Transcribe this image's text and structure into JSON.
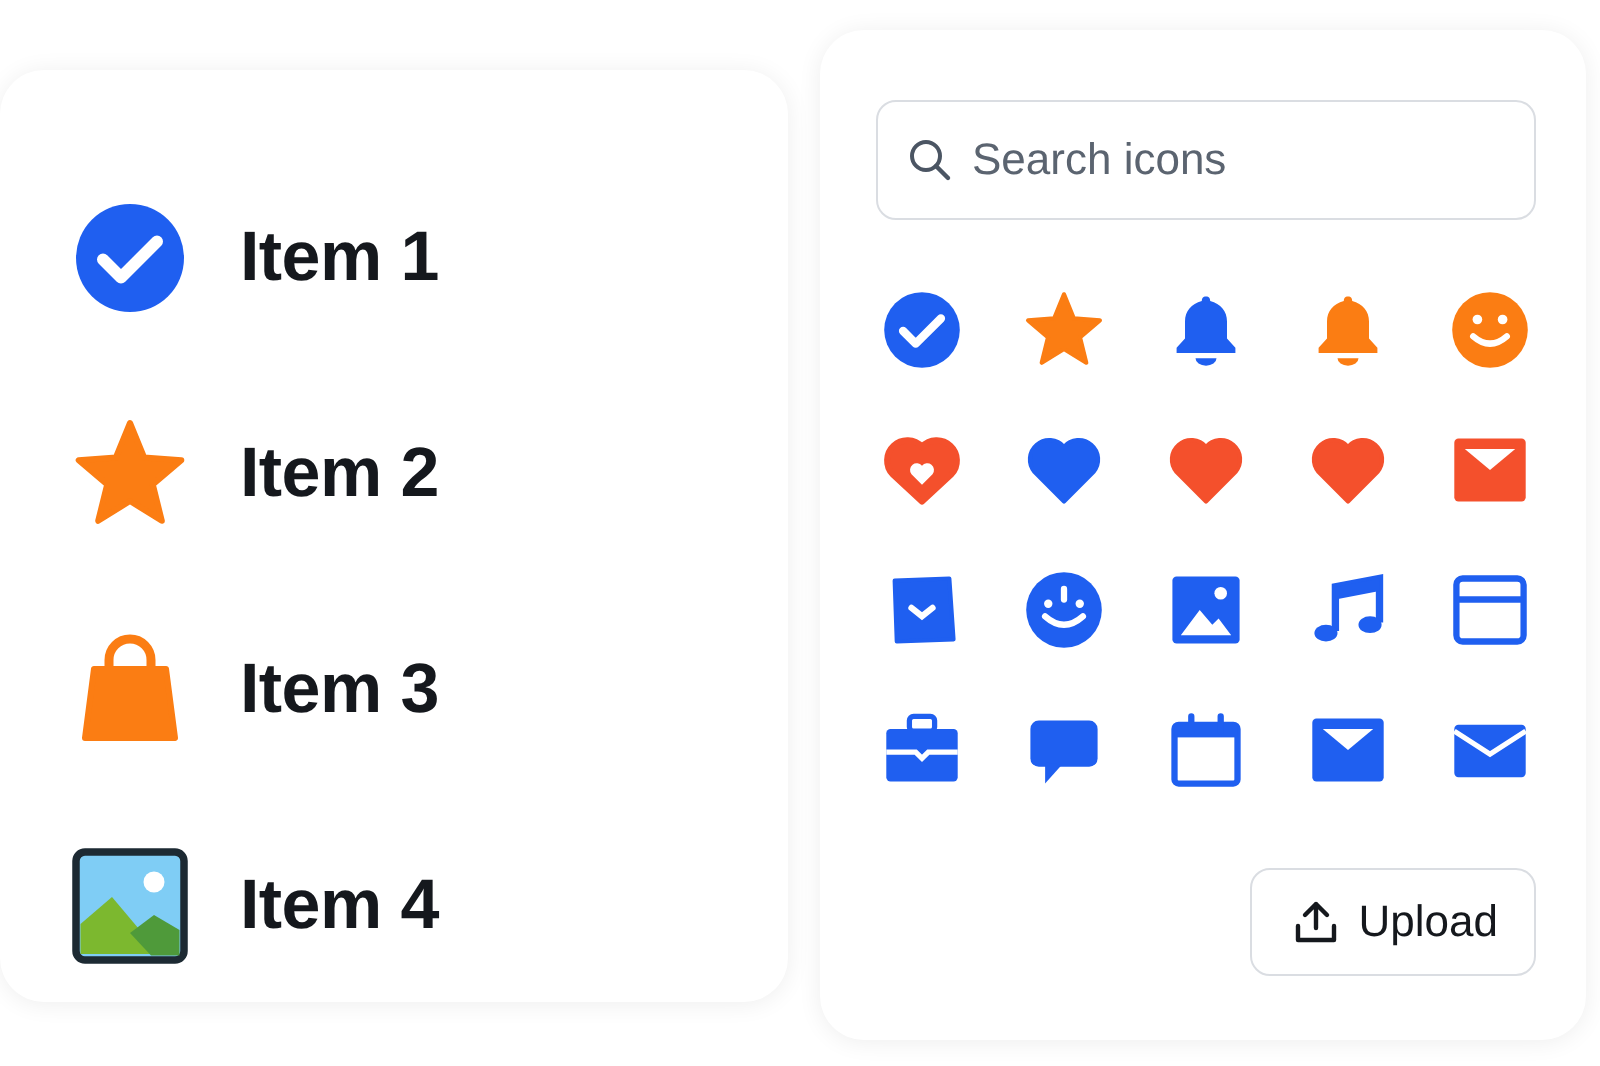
{
  "item_list": [
    {
      "label": "Item 1",
      "kind": "check-circle",
      "color": "#1f5ff0"
    },
    {
      "label": "Item 2",
      "kind": "star",
      "color": "#fb7d13"
    },
    {
      "label": "Item 3",
      "kind": "bag",
      "color": "#fb7d13"
    },
    {
      "label": "Item 4",
      "kind": "landscape-frame"
    }
  ],
  "icon_picker": {
    "search": {
      "placeholder": "Search icons"
    },
    "icons": [
      {
        "kind": "check-circle",
        "color": "#1f5ff0"
      },
      {
        "kind": "star",
        "color": "#fb7d13"
      },
      {
        "kind": "bell",
        "color": "#1f5ff0"
      },
      {
        "kind": "bell",
        "color": "#fb7d13"
      },
      {
        "kind": "smiley",
        "color": "#fb7d13"
      },
      {
        "kind": "heart-outline",
        "color": "#f4502c"
      },
      {
        "kind": "heart",
        "color": "#1f5ff0"
      },
      {
        "kind": "heart",
        "color": "#f4502c"
      },
      {
        "kind": "heart",
        "color": "#f4502c"
      },
      {
        "kind": "mail",
        "color": "#f4502c"
      },
      {
        "kind": "check-tag",
        "color": "#1f5ff0"
      },
      {
        "kind": "face",
        "color": "#1f5ff0"
      },
      {
        "kind": "image",
        "color": "#1f5ff0"
      },
      {
        "kind": "music",
        "color": "#1f5ff0"
      },
      {
        "kind": "window",
        "color": "#1f5ff0"
      },
      {
        "kind": "briefcase",
        "color": "#1f5ff0"
      },
      {
        "kind": "chat",
        "color": "#1f5ff0"
      },
      {
        "kind": "calendar",
        "color": "#1f5ff0"
      },
      {
        "kind": "mail",
        "color": "#1f5ff0"
      },
      {
        "kind": "envelope",
        "color": "#1f5ff0"
      }
    ],
    "upload_button": {
      "label": "Upload"
    }
  }
}
